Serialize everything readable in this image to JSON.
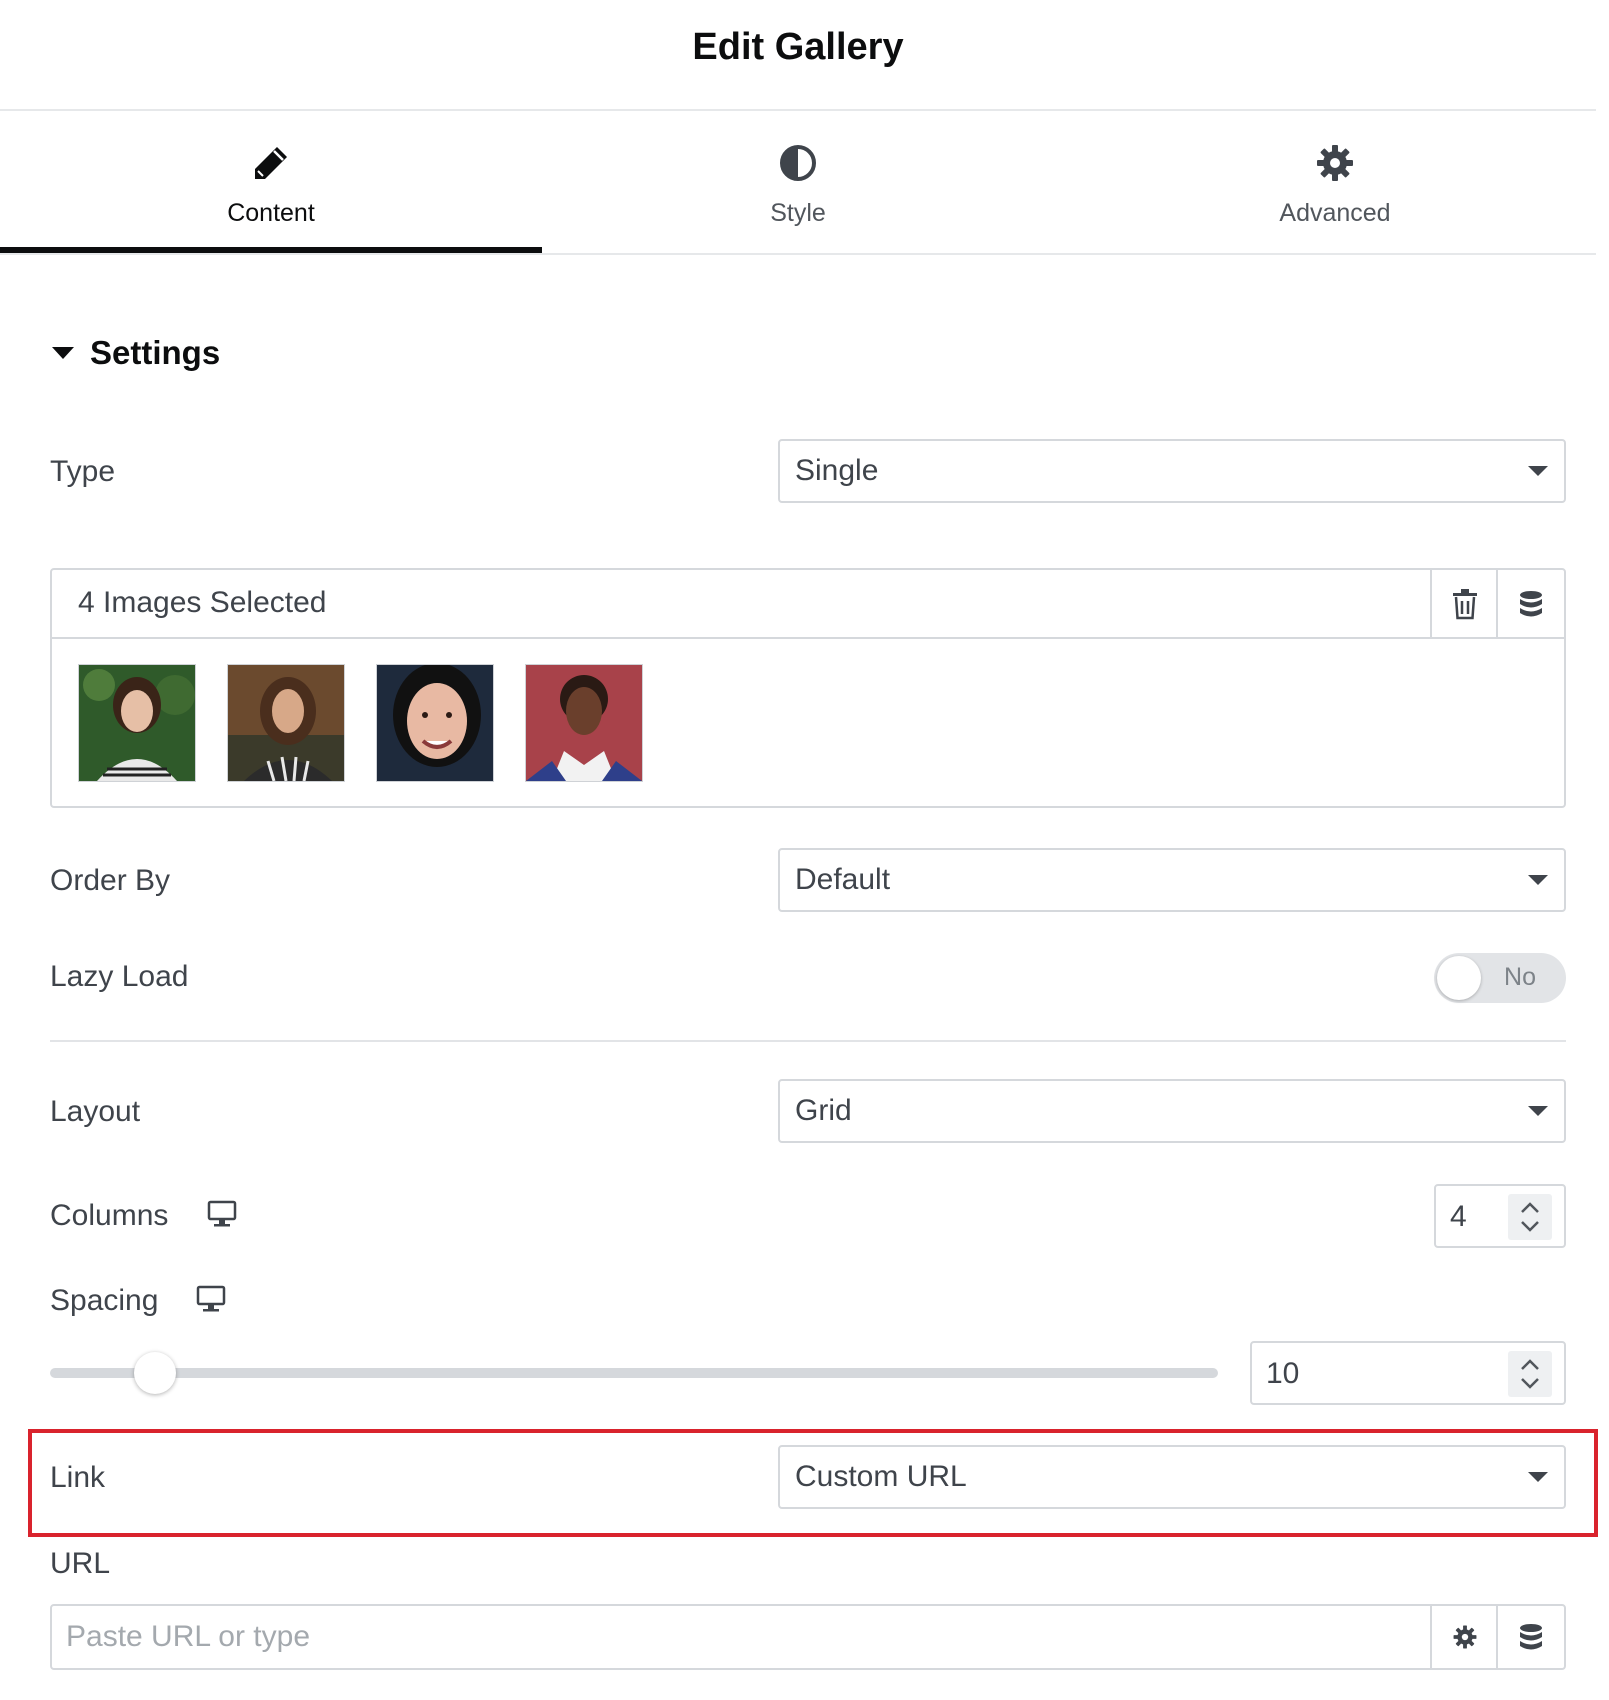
{
  "header": {
    "title": "Edit Gallery"
  },
  "tabs": [
    {
      "label": "Content",
      "icon": "pencil-icon",
      "active": true
    },
    {
      "label": "Style",
      "icon": "half-circle-icon",
      "active": false
    },
    {
      "label": "Advanced",
      "icon": "gear-icon",
      "active": false
    }
  ],
  "section": {
    "title": "Settings",
    "expanded": true
  },
  "type_field": {
    "label": "Type",
    "value": "Single"
  },
  "gallery": {
    "count_text": "4 Images Selected",
    "images": [
      {
        "icon": "portrait-thumbnail-1",
        "background": "#2f5a2a",
        "skin": "#e6bfa6",
        "hair": "#3a2418",
        "shirt": "#e9e9e9"
      },
      {
        "icon": "portrait-thumbnail-2",
        "background": "#6b4a2e",
        "skin": "#d7a888",
        "hair": "#4a2e1d",
        "shirt": "#2b2b2b"
      },
      {
        "icon": "portrait-thumbnail-3",
        "background": "#1e2a3c",
        "skin": "#e8b9a3",
        "hair": "#111111",
        "shirt": "#1e2a3c"
      },
      {
        "icon": "portrait-thumbnail-4",
        "background": "#a8424a",
        "skin": "#6a3f2c",
        "hair": "#2a1a14",
        "shirt": "#2e3f8a"
      }
    ]
  },
  "order_by": {
    "label": "Order By",
    "value": "Default"
  },
  "lazy_load": {
    "label": "Lazy Load",
    "state_text": "No",
    "enabled": false
  },
  "layout": {
    "label": "Layout",
    "value": "Grid"
  },
  "columns": {
    "label": "Columns",
    "value": "4",
    "device_icon": "desktop-icon"
  },
  "spacing": {
    "label": "Spacing",
    "value": "10",
    "device_icon": "desktop-icon",
    "slider_fraction": 0.09
  },
  "link": {
    "label": "Link",
    "value": "Custom URL"
  },
  "url": {
    "label": "URL",
    "placeholder": "Paste URL or type",
    "value": ""
  },
  "colors": {
    "highlight": "#d9232d",
    "active_tab": "#0c0d0e",
    "border": "#d5d8dc"
  }
}
